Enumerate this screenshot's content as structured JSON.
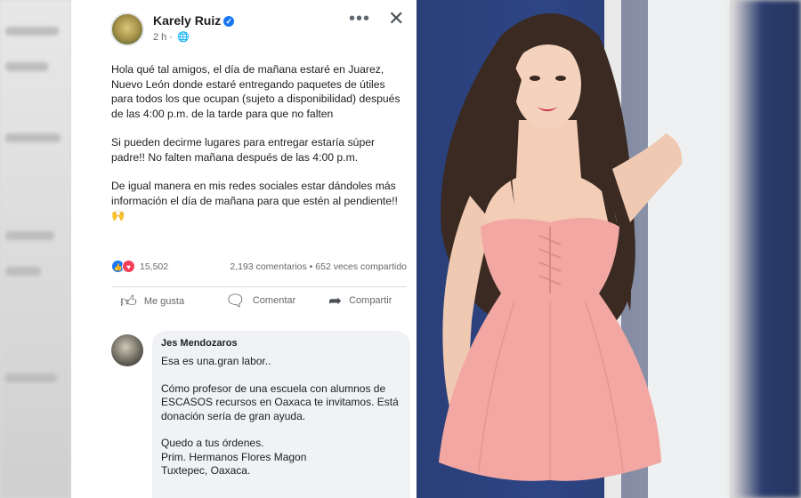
{
  "post": {
    "author": "Karely Ruiz",
    "verified_glyph": "✓",
    "time": "2 h ·",
    "more_glyph": "•••",
    "close_glyph": "✕",
    "paragraphs": [
      "Hola qué tal amigos, el día de mañana estaré en Juarez, Nuevo León donde estaré entregando paquetes de útiles para todos los que ocupan (sujeto a disponibilidad) después de las 4:00 p.m. de la tarde para que no falten",
      "Si pueden decirme lugares para entregar estaría súper padre!! No falten mañana después de las 4:00 p.m.",
      "De igual manera en mis redes sociales estar dándoles más información el día de mañana para que estén al pendiente!! 🙌"
    ],
    "reaction_count": "15,502",
    "counts": "2,193 comentarios • 652 veces compartido",
    "actions": {
      "like": "Me gusta",
      "comment": "Comentar",
      "share": "Compartir"
    }
  },
  "comment": {
    "name": "Jes Mendozaros",
    "lines": [
      "Esa es una.gran labor..",
      "Cómo profesor de una escuela con alumnos de ESCASOS recursos en Oaxaca te invitamos. Está donación sería de gran ayuda.",
      "Quedo a tus órdenes.",
      "Prim. Hermanos Flores Magon",
      "Tuxtepec, Oaxaca."
    ]
  },
  "colors": {
    "facebook_blue": "#1877f2",
    "love_red": "#f33e58",
    "dress_pink": "#f2a7a2"
  }
}
